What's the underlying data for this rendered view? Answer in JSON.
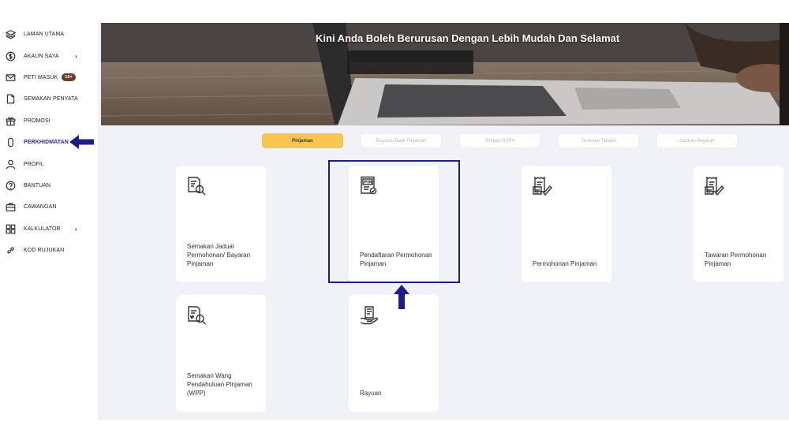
{
  "sidebar": {
    "items": [
      {
        "label": "LAMAN UTAMA",
        "icon": "layers-icon"
      },
      {
        "label": "AKAUN SAYA",
        "icon": "dollar-icon",
        "has_submenu": true
      },
      {
        "label": "PETI MASUK",
        "icon": "mail-icon",
        "badge": "10+"
      },
      {
        "label": "SEMAKAN PENYATA",
        "icon": "document-icon"
      },
      {
        "label": "PROMOSI",
        "icon": "gift-icon"
      },
      {
        "label": "PERKHIDMATAN",
        "icon": "mobile-icon",
        "active": true
      },
      {
        "label": "PROFIL",
        "icon": "user-icon"
      },
      {
        "label": "BANTUAN",
        "icon": "help-icon"
      },
      {
        "label": "CAWANGAN",
        "icon": "briefcase-icon"
      },
      {
        "label": "KALKULATOR",
        "icon": "calculator-icon",
        "has_submenu": true
      },
      {
        "label": "KOD RUJUKAN",
        "icon": "link-icon"
      }
    ],
    "chevron": "›"
  },
  "banner": {
    "title": "Kini Anda Boleh Berurusan Dengan Lebih Mudah Dan Selamat"
  },
  "tabs": [
    {
      "label": "Pinjaman",
      "active": true
    },
    {
      "label": "Bayaran Balik Pinjaman"
    },
    {
      "label": "Simpan SSPN"
    },
    {
      "label": "Tuntutan Takaful"
    },
    {
      "label": "Saluran Bayaran"
    }
  ],
  "cards": [
    {
      "label": "Semakan Jadual Permohonan/ Bayaran Pinjaman",
      "icon": "document-search-icon"
    },
    {
      "label": "Pendaftaran Permohonan Pinjaman",
      "icon": "pin-document-icon",
      "highlighted": true,
      "icon_text": "PIN"
    },
    {
      "label": "Permohonan Pinjaman",
      "icon": "document-sign-icon"
    },
    {
      "label": "Tawaran Permohonan Pinjaman",
      "icon": "offer-document-icon"
    },
    {
      "label": "Semakan Wang Pendahuluan Pinjaman (WPP)",
      "icon": "wpp-search-icon"
    },
    {
      "label": "Rayuan",
      "icon": "hand-document-icon"
    }
  ],
  "colors": {
    "accent_tab": "#f7c84f",
    "annotation_blue": "#1c1c8c",
    "active_nav": "#2b2b91",
    "badge": "#6b3e2a",
    "content_bg": "#f1f2f8"
  }
}
